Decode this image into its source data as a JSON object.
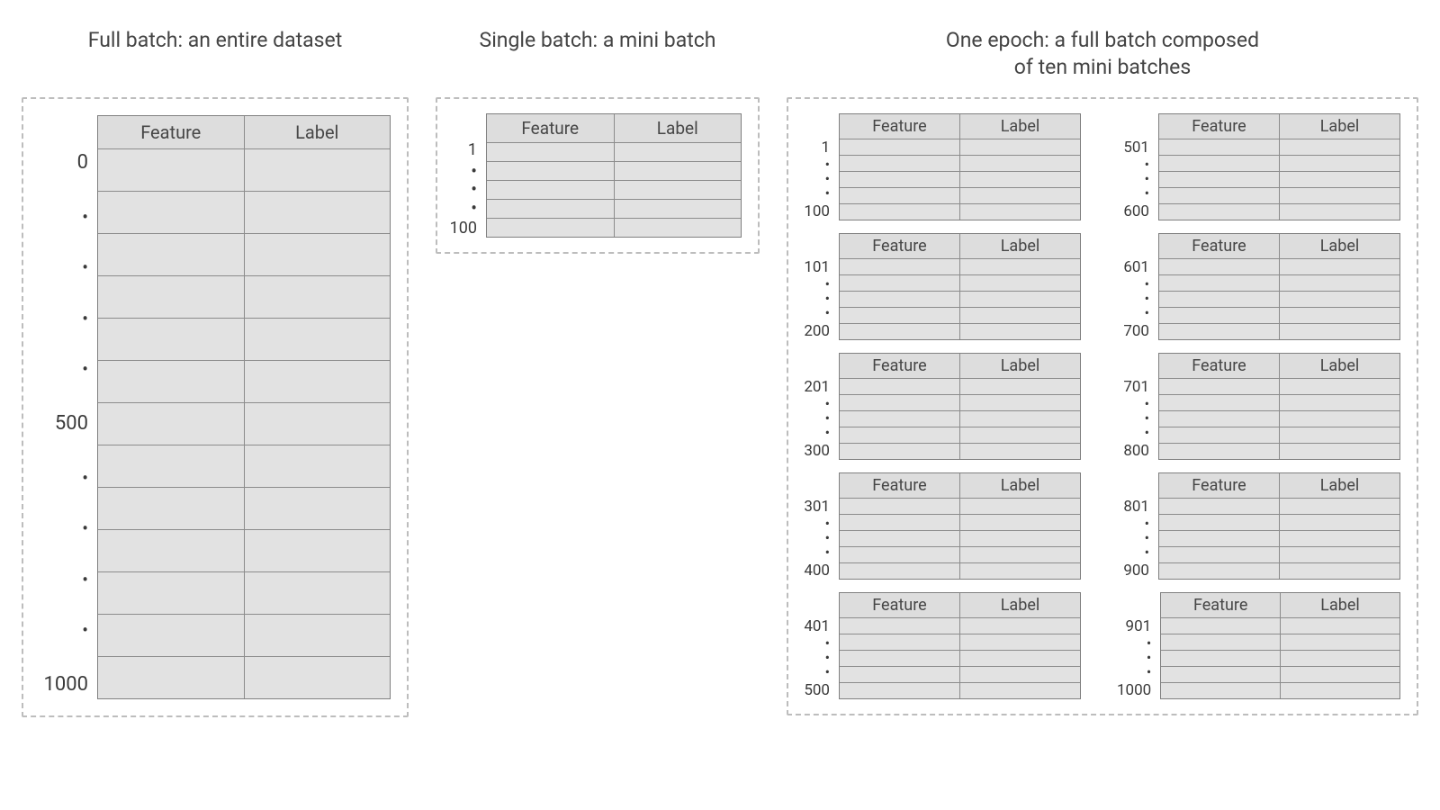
{
  "headers": {
    "feature": "Feature",
    "label": "Label"
  },
  "full": {
    "title": "Full batch: an entire dataset",
    "ticks": [
      "0",
      "500",
      "1000"
    ]
  },
  "single": {
    "title": "Single batch: a mini batch",
    "start": "1",
    "end": "100"
  },
  "epoch": {
    "title": "One epoch: a full batch composed of ten mini batches",
    "batches": [
      {
        "start": "1",
        "end": "100"
      },
      {
        "start": "101",
        "end": "200"
      },
      {
        "start": "201",
        "end": "300"
      },
      {
        "start": "301",
        "end": "400"
      },
      {
        "start": "401",
        "end": "500"
      },
      {
        "start": "501",
        "end": "600"
      },
      {
        "start": "601",
        "end": "700"
      },
      {
        "start": "701",
        "end": "800"
      },
      {
        "start": "801",
        "end": "900"
      },
      {
        "start": "901",
        "end": "1000"
      }
    ]
  },
  "dot": "•"
}
